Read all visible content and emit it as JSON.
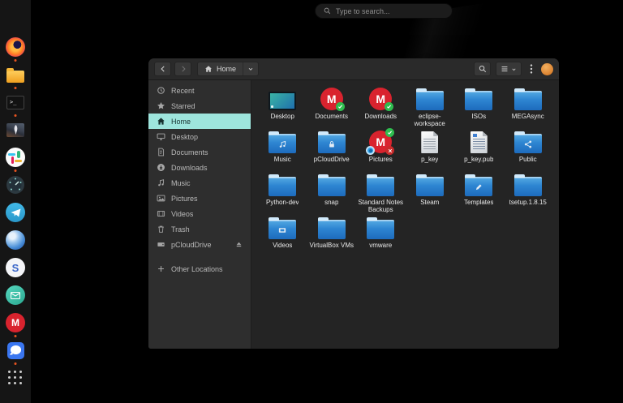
{
  "colors": {
    "accent_selection": "#9ee5dd",
    "folder_blue": "#2e86d2",
    "mega_red": "#d9232e",
    "check_green": "#2fbd4f",
    "avatar_orange": "#d97f2c",
    "running_dot": "#e95420",
    "header_bg": "#2a2a2a",
    "sidebar_bg": "#2e2e2e",
    "content_bg": "#242424",
    "dock_bg": "#151515"
  },
  "overview": {
    "search_placeholder": "Type to search...",
    "search_icon": "search-icon"
  },
  "dock": {
    "items": [
      {
        "id": "firefox",
        "icon": "firefox-icon",
        "running": true
      },
      {
        "id": "files",
        "icon": "files-folder-icon",
        "running": true
      },
      {
        "id": "terminal",
        "icon": "terminal-icon",
        "running": true
      },
      {
        "id": "image-viewer",
        "icon": "rocket-image-icon",
        "running": false
      },
      {
        "id": "slack",
        "icon": "slack-icon",
        "running": true
      },
      {
        "id": "gauge-app",
        "icon": "gauge-icon",
        "running": false
      },
      {
        "id": "telegram",
        "icon": "telegram-icon",
        "running": false
      },
      {
        "id": "browser",
        "icon": "browser-globe-icon",
        "running": false
      },
      {
        "id": "standard-notes",
        "icon": "standard-notes-icon",
        "running": false
      },
      {
        "id": "mail",
        "icon": "mail-envelope-icon",
        "running": false
      },
      {
        "id": "mega",
        "icon": "mega-icon",
        "running": true
      },
      {
        "id": "signal",
        "icon": "signal-icon",
        "running": true
      },
      {
        "id": "app-grid",
        "icon": "app-grid-icon",
        "running": false
      }
    ]
  },
  "file_window": {
    "header": {
      "location_label": "Home",
      "left_icons": [
        "back-icon",
        "forward-icon",
        "home-icon",
        "chevron-down-icon"
      ],
      "right_icons": [
        "search-icon",
        "list-view-icon",
        "chevron-down-icon",
        "menu-kebab-icon",
        "avatar"
      ]
    },
    "sidebar": {
      "items": [
        {
          "label": "Recent",
          "icon": "clock-icon"
        },
        {
          "label": "Starred",
          "icon": "star-icon"
        },
        {
          "label": "Home",
          "icon": "home-icon",
          "selected": true
        },
        {
          "label": "Desktop",
          "icon": "desktop-icon"
        },
        {
          "label": "Documents",
          "icon": "document-icon"
        },
        {
          "label": "Downloads",
          "icon": "downloads-icon"
        },
        {
          "label": "Music",
          "icon": "music-icon"
        },
        {
          "label": "Pictures",
          "icon": "pictures-icon"
        },
        {
          "label": "Videos",
          "icon": "videos-icon"
        },
        {
          "label": "Trash",
          "icon": "trash-icon"
        },
        {
          "label": "pCloudDrive",
          "icon": "drive-icon",
          "eject": true
        },
        {
          "label": "Other Locations",
          "icon": "plus-icon",
          "spacer_before": true
        }
      ]
    },
    "files": [
      {
        "label": "Desktop",
        "icon": "desktop-screen"
      },
      {
        "label": "Documents",
        "icon": "mega-synced"
      },
      {
        "label": "Downloads",
        "icon": "mega-synced"
      },
      {
        "label": "eclipse-workspace",
        "icon": "folder"
      },
      {
        "label": "ISOs",
        "icon": "folder"
      },
      {
        "label": "MEGAsync",
        "icon": "folder"
      },
      {
        "label": "Music",
        "icon": "folder",
        "emblem": "music"
      },
      {
        "label": "pCloudDrive",
        "icon": "folder",
        "emblem": "lock"
      },
      {
        "label": "Pictures",
        "icon": "mega-badged"
      },
      {
        "label": "p_key",
        "icon": "document"
      },
      {
        "label": "p_key.pub",
        "icon": "document-pub"
      },
      {
        "label": "Public",
        "icon": "folder",
        "emblem": "share"
      },
      {
        "label": "Python-dev",
        "icon": "folder"
      },
      {
        "label": "snap",
        "icon": "folder"
      },
      {
        "label": "Standard Notes Backups",
        "icon": "folder"
      },
      {
        "label": "Steam",
        "icon": "folder"
      },
      {
        "label": "Templates",
        "icon": "folder",
        "emblem": "template"
      },
      {
        "label": "tsetup.1.8.15",
        "icon": "folder"
      },
      {
        "label": "Videos",
        "icon": "folder",
        "emblem": "video"
      },
      {
        "label": "VirtualBox VMs",
        "icon": "folder"
      },
      {
        "label": "vmware",
        "icon": "folder"
      }
    ]
  }
}
